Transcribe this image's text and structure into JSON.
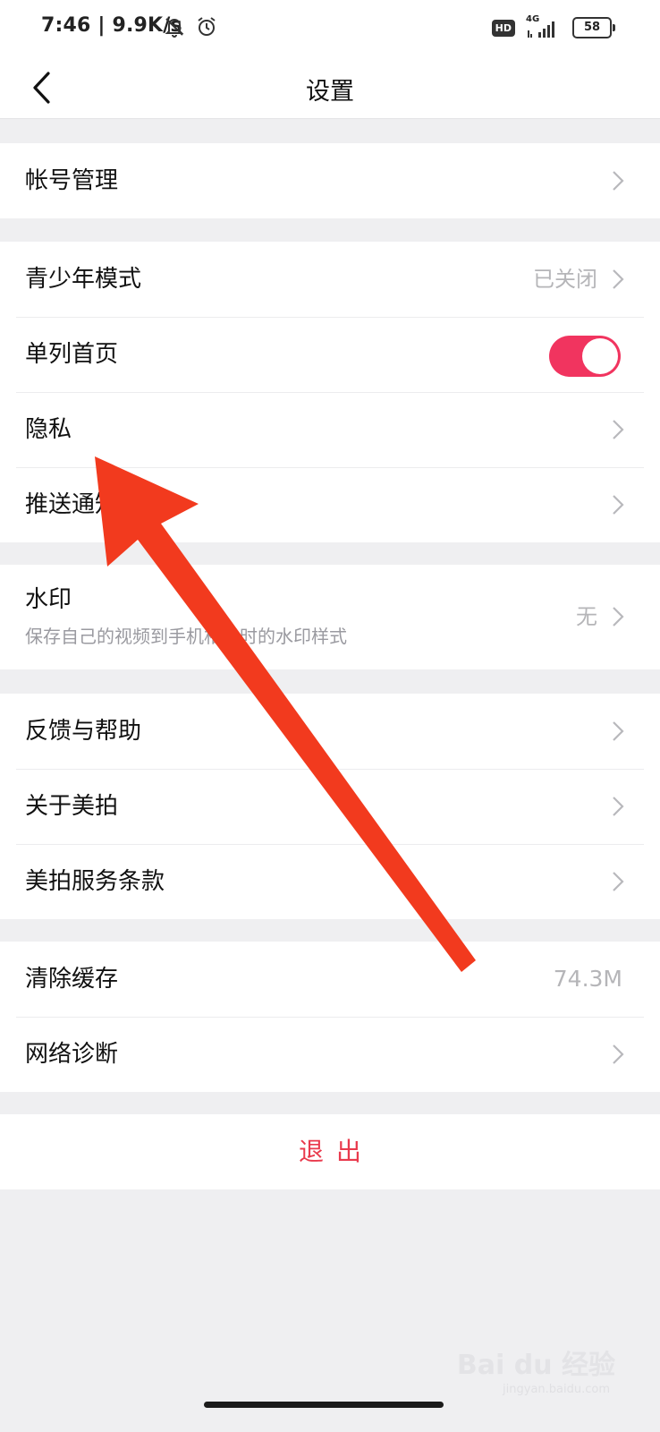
{
  "status_bar": {
    "time": "7:46 | 9.9K/s",
    "network_type": "4G",
    "hd_badge": "HD",
    "battery": "58"
  },
  "header": {
    "title": "设置",
    "back_icon": "chevron-left-icon"
  },
  "sections": {
    "account": {
      "label": "帐号管理"
    },
    "teen_mode": {
      "label": "青少年模式",
      "value": "已关闭"
    },
    "single_column": {
      "label": "单列首页",
      "toggle_on": true
    },
    "privacy": {
      "label": "隐私"
    },
    "push": {
      "label": "推送通知"
    },
    "watermark": {
      "label": "水印",
      "sub": "保存自己的视频到手机相册时的水印样式",
      "value": "无"
    },
    "feedback": {
      "label": "反馈与帮助"
    },
    "about": {
      "label": "关于美拍"
    },
    "terms": {
      "label": "美拍服务条款"
    },
    "cache": {
      "label": "清除缓存",
      "value": "74.3M"
    },
    "diagnosis": {
      "label": "网络诊断"
    }
  },
  "logout": {
    "label": "退出"
  },
  "watermark_logo": {
    "brand": "Bai du 经验",
    "sub": "jingyan.baidu.com"
  },
  "colors": {
    "accent_toggle": "#f1345f",
    "logout_text": "#e93a4d",
    "annotation_arrow": "#f23a1e",
    "background": "#efeff1"
  }
}
